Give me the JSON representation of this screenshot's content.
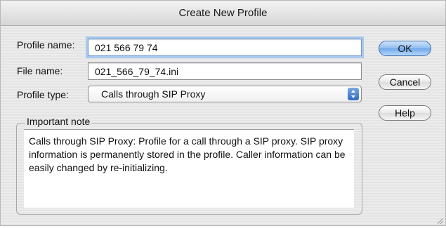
{
  "window": {
    "title": "Create New Profile"
  },
  "form": {
    "profile_name_label": "Profile name:",
    "profile_name_value": "021 566 79 74",
    "file_name_label": "File name:",
    "file_name_value": "021_566_79_74.ini",
    "profile_type_label": "Profile type:",
    "profile_type_value": "Calls through SIP Proxy"
  },
  "buttons": {
    "ok_label": "OK",
    "cancel_label": "Cancel",
    "help_label": "Help"
  },
  "note": {
    "title": "Important note",
    "text": "Calls through SIP Proxy: Profile for a call through a SIP proxy. SIP proxy information is permanently stored in the profile. Caller information can be easily changed by re-initializing."
  },
  "icons": [
    "select-arrows-icon",
    "resize-grip-icon"
  ],
  "colors": {
    "default_button": "#6ea7ea",
    "focus_ring": "#a9c8ee"
  }
}
